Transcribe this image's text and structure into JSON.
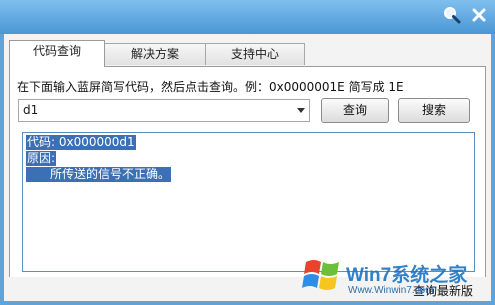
{
  "titlebar": {
    "search_icon": "magnifier-icon",
    "close_icon": "close-icon"
  },
  "tabs": [
    {
      "label": "代码查询",
      "active": true
    },
    {
      "label": "解决方案",
      "active": false
    },
    {
      "label": "支持中心",
      "active": false
    }
  ],
  "instruction": "在下面输入蓝屏简写代码，然后点击查询。例：0x0000001E 简写成 1E",
  "code_input": {
    "value": "d1"
  },
  "buttons": {
    "query": "查询",
    "search": "搜索"
  },
  "result": {
    "line1": "代码: 0x000000d1",
    "line2": "原因:",
    "line3": "所传送的信号不正确。"
  },
  "footer": {
    "update_link": "查询最新版"
  },
  "watermark": {
    "brand": "Win7系统之家",
    "url": "Www.Winwin7.com"
  },
  "colors": {
    "accent": "#4a96d4",
    "selection": "#3b6fb6",
    "result_border": "#5b8fc2"
  }
}
